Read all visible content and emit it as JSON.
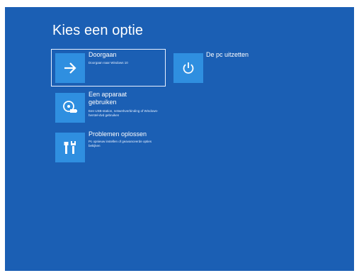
{
  "screen": {
    "title": "Kies een optie",
    "background": "#1b5fb4",
    "tile_color": "#2f8fe0"
  },
  "options": [
    {
      "label": "Doorgaan",
      "description": "Doorgaan naar Windows 10",
      "icon": "arrow-right-icon",
      "selected": true
    },
    {
      "label": "De pc uitzetten",
      "description": "",
      "icon": "power-icon",
      "selected": false
    },
    {
      "label": "Een apparaat gebruiken",
      "description": "Een USB-station, netwerkverbinding of Windows-herstel-dvd gebruiken",
      "icon": "disc-usb-icon",
      "selected": false
    },
    {
      "label": "Problemen oplossen",
      "description": "Pc opnieuw instellen of geavanceerde opties bekijken",
      "icon": "tools-icon",
      "selected": false
    }
  ]
}
